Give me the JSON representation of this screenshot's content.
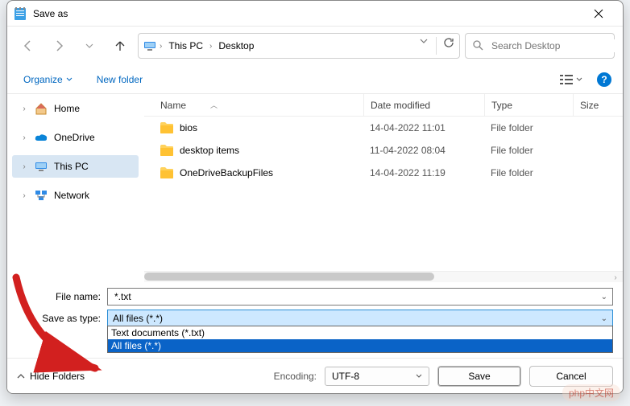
{
  "window": {
    "title": "Save as"
  },
  "nav": {
    "refresh": "↻",
    "up": "↑"
  },
  "path": {
    "crumb1": "This PC",
    "crumb2": "Desktop"
  },
  "search": {
    "placeholder": "Search Desktop"
  },
  "toolbar": {
    "organize": "Organize",
    "newfolder": "New folder",
    "help": "?"
  },
  "sidebar": {
    "items": [
      {
        "label": "Home"
      },
      {
        "label": "OneDrive"
      },
      {
        "label": "This PC"
      },
      {
        "label": "Network"
      }
    ]
  },
  "columns": {
    "name": "Name",
    "date": "Date modified",
    "type": "Type",
    "size": "Size"
  },
  "rows": [
    {
      "name": "bios",
      "date": "14-04-2022 11:01",
      "type": "File folder"
    },
    {
      "name": "desktop items",
      "date": "11-04-2022 08:04",
      "type": "File folder"
    },
    {
      "name": "OneDriveBackupFiles",
      "date": "14-04-2022 11:19",
      "type": "File folder"
    }
  ],
  "form": {
    "filename_label": "File name:",
    "filename_value": "*.txt",
    "savetype_label": "Save as type:",
    "savetype_value": "All files  (*.*)"
  },
  "dropdown": {
    "opt1": "Text documents (*.txt)",
    "opt2": "All files  (*.*)"
  },
  "footer": {
    "hidefolders": "Hide Folders",
    "encoding_label": "Encoding:",
    "encoding_value": "UTF-8",
    "save": "Save",
    "cancel": "Cancel"
  },
  "watermark": "php中文网"
}
